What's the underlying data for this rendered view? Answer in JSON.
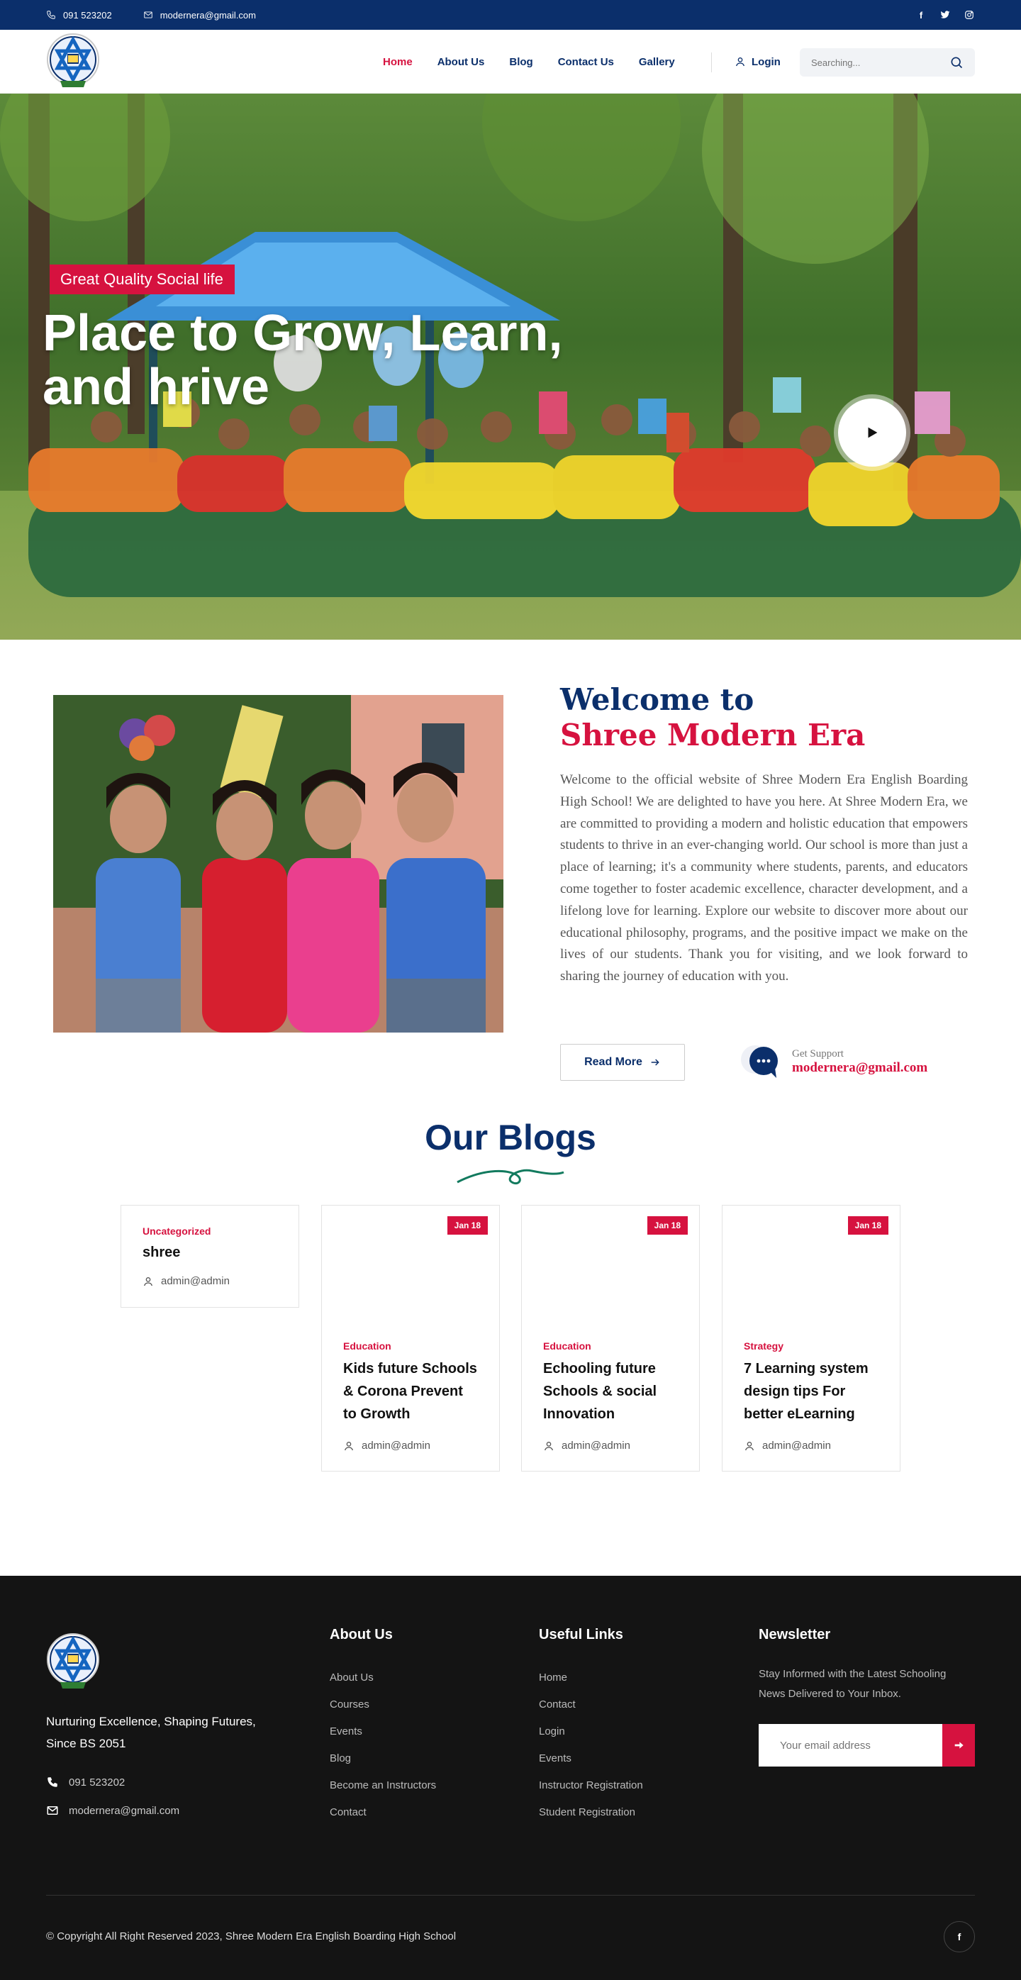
{
  "topbar": {
    "phone": "091 523202",
    "email": "modernera@gmail.com",
    "socials": [
      "facebook-icon",
      "twitter-icon",
      "instagram-icon"
    ]
  },
  "header": {
    "nav": [
      {
        "label": "Home",
        "active": true
      },
      {
        "label": "About Us",
        "active": false
      },
      {
        "label": "Blog",
        "active": false
      },
      {
        "label": "Contact Us",
        "active": false
      },
      {
        "label": "Gallery",
        "active": false
      }
    ],
    "login_label": "Login",
    "search_placeholder": "Searching..."
  },
  "hero": {
    "tag": "Great Quality Social life",
    "title": "Place to Grow, Learn, and hrive"
  },
  "welcome": {
    "heading_line1": "Welcome to",
    "heading_line2": "Shree Modern Era",
    "body": "Welcome to the official website of Shree Modern Era English Boarding High School! We are delighted to have you here. At Shree Modern Era, we are committed to providing a modern and holistic education that empowers students to thrive in an ever-changing world. Our school is more than just a place of learning; it's a community where students, parents, and educators come together to foster academic excellence, character development, and a lifelong love for learning. Explore our website to discover more about our educational philosophy, programs, and the positive impact we make on the lives of our students. Thank you for visiting, and we look forward to sharing the journey of education with you.",
    "read_more": "Read More",
    "support_label": "Get Support",
    "support_email": "modernera@gmail.com"
  },
  "blogs": {
    "title": "Our Blogs",
    "posts": [
      {
        "date": "",
        "category": "Uncategorized",
        "title": "shree",
        "author": "admin@admin"
      },
      {
        "date": "Jan 18",
        "category": "Education",
        "title": "Kids future Schools & Corona Prevent to Growth",
        "author": "admin@admin"
      },
      {
        "date": "Jan 18",
        "category": "Education",
        "title": "Echooling future Schools & social Innovation",
        "author": "admin@admin"
      },
      {
        "date": "Jan 18",
        "category": "Strategy",
        "title": "7 Learning system design tips For better eLearning",
        "author": "admin@admin"
      }
    ]
  },
  "footer": {
    "tagline": "Nurturing Excellence, Shaping Futures, Since BS 2051",
    "phone": "091 523202",
    "email": "modernera@gmail.com",
    "about_title": "About Us",
    "about_links": [
      "About Us",
      "Courses",
      "Events",
      "Blog",
      "Become an Instructors",
      "Contact"
    ],
    "useful_title": "Useful Links",
    "useful_links": [
      "Home",
      "Contact",
      "Login",
      "Events",
      "Instructor Registration",
      "Student Registration"
    ],
    "newsletter_title": "Newsletter",
    "newsletter_text": "Stay Informed with the Latest Schooling News Delivered to Your Inbox.",
    "newsletter_placeholder": "Your email address",
    "copyright": "© Copyright All Right Reserved 2023, Shree Modern Era English Boarding High School"
  },
  "colors": {
    "navy": "#0b2f6b",
    "accent": "#d6123f",
    "footer_bg": "#141414"
  }
}
